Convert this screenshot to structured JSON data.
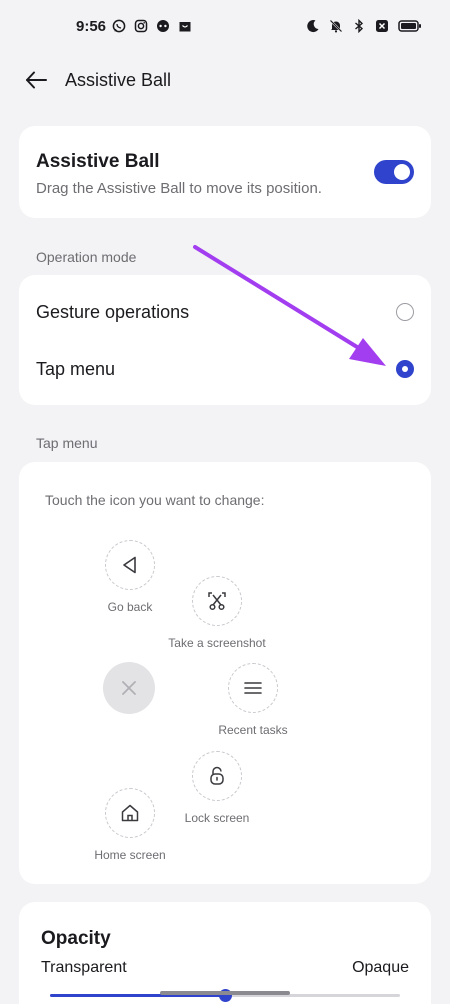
{
  "status_bar": {
    "time": "9:56",
    "left_icons": [
      "whatsapp-icon",
      "instagram-icon",
      "messenger-icon",
      "bag-icon"
    ],
    "right_icons": [
      "moon-icon",
      "mute-icon",
      "bluetooth-icon",
      "battery-saver-icon",
      "battery-icon"
    ]
  },
  "header": {
    "title": "Assistive Ball"
  },
  "assistive_ball": {
    "title": "Assistive Ball",
    "subtitle": "Drag the Assistive Ball to move its position.",
    "enabled": true
  },
  "operation_mode": {
    "label": "Operation mode",
    "options": [
      {
        "label": "Gesture operations",
        "selected": false
      },
      {
        "label": "Tap menu",
        "selected": true
      }
    ]
  },
  "tap_menu": {
    "label": "Tap menu",
    "hint": "Touch the icon you want to change:",
    "items": {
      "go_back": "Go back",
      "screenshot": "Take a screenshot",
      "recent": "Recent tasks",
      "lock": "Lock screen",
      "home": "Home screen"
    }
  },
  "opacity": {
    "title": "Opacity",
    "min_label": "Transparent",
    "max_label": "Opaque",
    "value_fraction": 0.5
  },
  "colors": {
    "accent": "#2f43cc",
    "annotation_arrow": "#a23ef0"
  }
}
